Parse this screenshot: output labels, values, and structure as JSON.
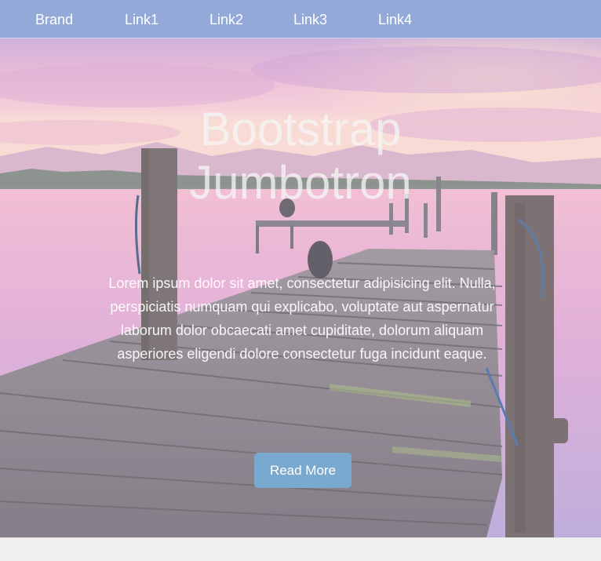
{
  "navbar": {
    "brand": "Brand",
    "links": [
      "Link1",
      "Link2",
      "Link3",
      "Link4"
    ]
  },
  "jumbotron": {
    "title_line1": "Bootstrap",
    "title_line2": "Jumbotron",
    "body": "Lorem ipsum dolor sit amet, consectetur adipisicing elit. Nulla, perspiciatis numquam qui explicabo, voluptate aut aspernatur laborum dolor obcaecati amet cupiditate, dolorum aliquam asperiores eligendi dolore consectetur fuga incidunt eaque.",
    "button_label": "Read More",
    "background_image": "wooden-pier-lake-sunset"
  },
  "colors": {
    "navbar_bg": "#93a9d8",
    "button_bg": "#7aa9cf",
    "page_bg": "#efefef"
  }
}
